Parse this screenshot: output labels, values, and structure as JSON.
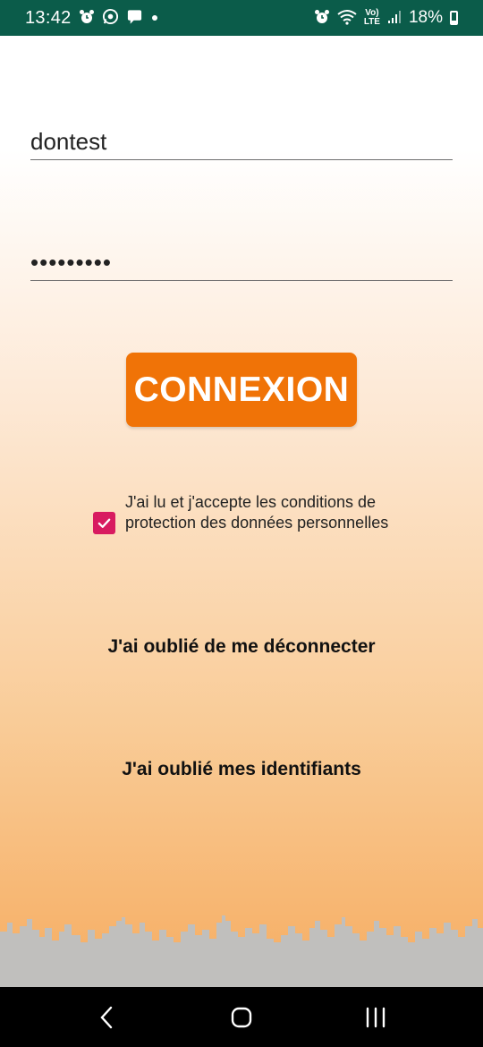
{
  "status_bar": {
    "time": "13:42",
    "battery": "18%",
    "lte_top": "Vo)",
    "lte_bottom": "LTE"
  },
  "login": {
    "username_value": "dontest",
    "password_masked": "•••••••••",
    "connect_label": "CONNEXION"
  },
  "consent": {
    "checked": true,
    "label": "J'ai lu et j'accepte les conditions de protection des données personnelles"
  },
  "links": {
    "forgot_logout": "J'ai oublié de me déconnecter",
    "forgot_credentials": "J'ai oublié mes identifiants"
  },
  "colors": {
    "status_bar": "#0b5c4a",
    "button": "#f07307",
    "checkbox": "#d81b60",
    "skyline": "#c0bfbd"
  }
}
